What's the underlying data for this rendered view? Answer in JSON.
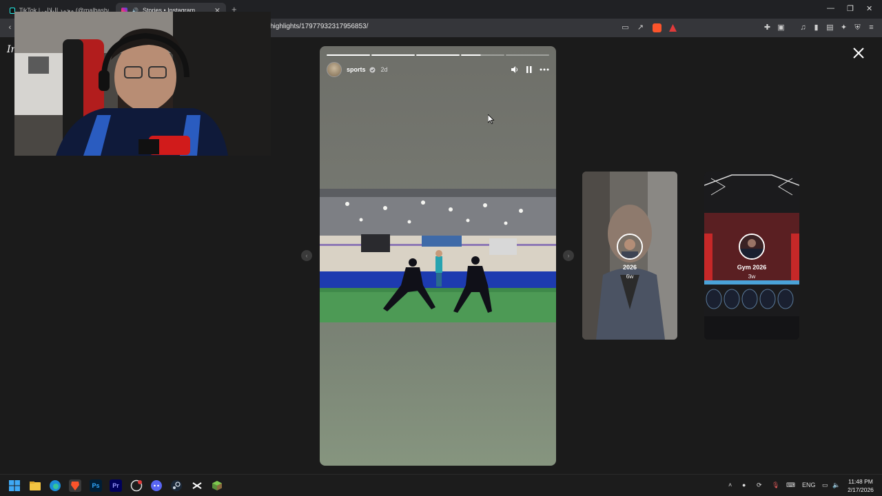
{
  "browser": {
    "tabs": [
      {
        "label": "TikTok | محمد البلالي (@malbasha2)(+99)",
        "active": false
      },
      {
        "label": "Stories • Instagram",
        "active": true
      }
    ],
    "new_tab_label": "+",
    "url": "highlights/17977932317956853/"
  },
  "page": {
    "logo_text": "In",
    "story": {
      "username": "sports",
      "time": "2d",
      "progress_segments": 5,
      "current_segment_progress": 0.45,
      "completed_segments": 3
    },
    "previews": [
      {
        "title": "2026",
        "age": "6w"
      },
      {
        "title": "Gym 2026",
        "age": "3w"
      }
    ]
  },
  "taskbar": {
    "apps": [
      "start-icon",
      "file-explorer-icon",
      "edge-icon",
      "brave-icon",
      "photoshop-icon",
      "premiere-icon",
      "obs-icon",
      "discord-icon",
      "steam-icon",
      "capcut-icon",
      "minecraft-icon"
    ],
    "ps_label": "Ps",
    "pr_label": "Pr",
    "language": "ENG",
    "time": "11:48 PM",
    "date": "2/17/2026"
  },
  "colors": {
    "brave": "#fb542b",
    "instagram": "#d6249f",
    "discord": "#5865f2"
  }
}
